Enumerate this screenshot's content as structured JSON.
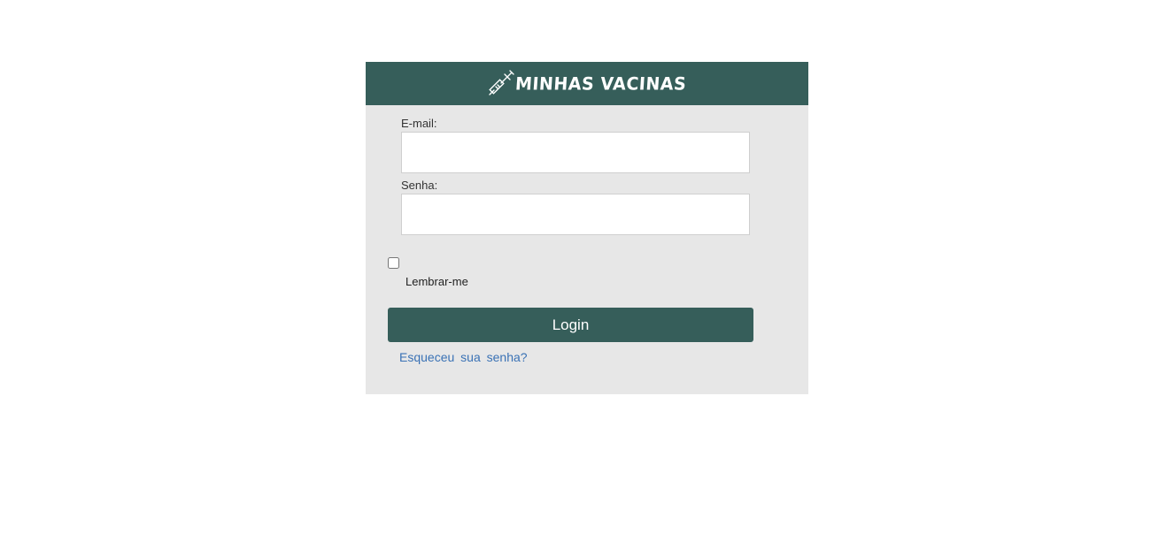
{
  "header": {
    "title": "MINHAS VACINAS",
    "icon": "syringe-icon"
  },
  "form": {
    "email_label": "E-mail:",
    "email_value": "",
    "password_label": "Senha:",
    "password_value": "",
    "remember_label": "Lembrar-me",
    "remember_checked": false,
    "login_button": "Login",
    "forgot_link": "Esqueceu sua senha?"
  },
  "colors": {
    "brand": "#365e5a",
    "card_background": "#e7e7e7",
    "link": "#3a72b5"
  }
}
